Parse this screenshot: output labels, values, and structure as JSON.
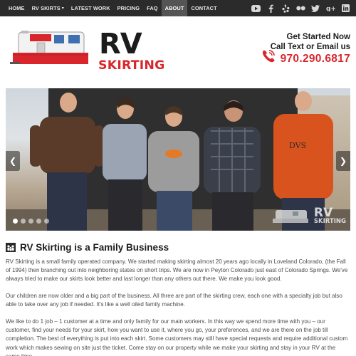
{
  "nav": {
    "items": [
      {
        "label": "HOME",
        "active": false
      },
      {
        "label": "RV SKIRTS",
        "active": false,
        "has_dropdown": true
      },
      {
        "label": "LATEST WORK",
        "active": false
      },
      {
        "label": "PRICING",
        "active": false
      },
      {
        "label": "FAQ",
        "active": false
      },
      {
        "label": "ABOUT",
        "active": true
      },
      {
        "label": "CONTACT",
        "active": false
      }
    ],
    "dropdown_glyph": "▾",
    "social_icons": [
      "youtube-icon",
      "facebook-icon",
      "yelp-icon",
      "flickr-icon",
      "twitter-icon",
      "google-plus-icon",
      "linkedin-icon"
    ]
  },
  "header": {
    "logo_rv": "RV",
    "logo_skirting": "SKIRTING",
    "cta_line1": "Get Started Now",
    "cta_line2": "Call Text or Email us",
    "phone": "970.290.6817"
  },
  "slider": {
    "prev_glyph": "❮",
    "next_glyph": "❯",
    "dots_total": 5,
    "active_dot": 1,
    "watermark_rv": "RV",
    "watermark_skirting": "SKIRTING"
  },
  "content": {
    "heading": "RV Skirting is a Family Business",
    "p1": "RV Skirting is a small family operated company.  We started making skirting almost 20 years ago locally in Loveland Colorado, (the Fall of 1994) then branching out into neighboring states on short trips. We are now in Peyton Colorado just east of Colorado Springs. We've always tried to make our skirts look better and last longer than any others out there. We make you look good.",
    "p2": "Our children are now older and a big part of the business. All three are part of the skirting crew, each one with a specialty job but also able to take over any job if needed. It's like a well oiled family machine.",
    "p3": "We like to do 1 job – 1 customer at a time and only family for our main workers. In this way we spend more time with you – our customer, find your needs for your skirt, how you want to use it, where you go, your preferences, and we are there on the job till completion. The best of everything is put into each skirt. Some customers may still have special requests and require additional custom work which makes sewing on site just the ticket. Come stay on our property while we make your skirting and stay in your RV at the same time."
  },
  "colors": {
    "nav_bg": "#2b2b2b",
    "nav_active": "#555555",
    "brand_red": "#d9262c",
    "brand_dark": "#1c1c1c"
  }
}
